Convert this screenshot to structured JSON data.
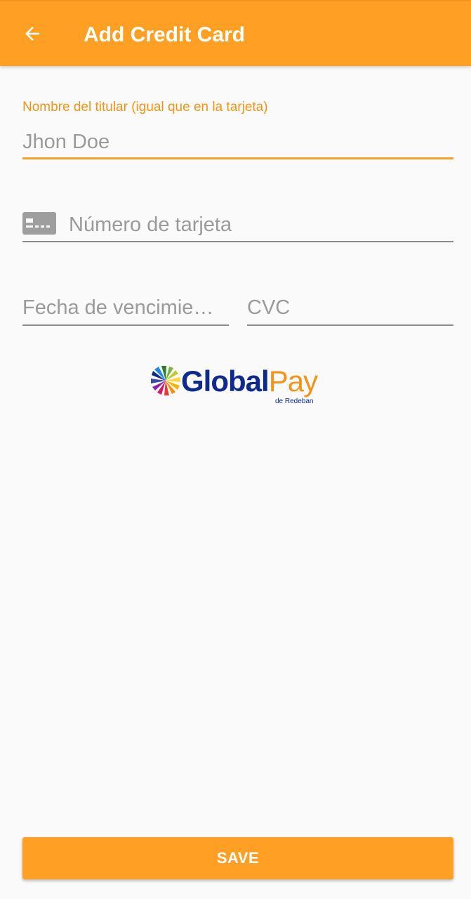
{
  "appbar": {
    "title": "Add Credit Card",
    "back_icon": "arrow-left-icon",
    "color": "#ffa024"
  },
  "form": {
    "holder_name": {
      "label": "Nombre del titular (igual que en la tarjeta)",
      "value": "Jhon Doe"
    },
    "card_number": {
      "placeholder": "Número de tarjeta",
      "icon": "credit-card-icon"
    },
    "expiry": {
      "placeholder": "Fecha de vencimiento",
      "display": "Fecha de vencimie…"
    },
    "cvc": {
      "placeholder": "CVC"
    }
  },
  "logo": {
    "name_part1": "Global",
    "name_part2": "Pay",
    "subtitle": "de Redeban"
  },
  "actions": {
    "save_label": "SAVE"
  }
}
